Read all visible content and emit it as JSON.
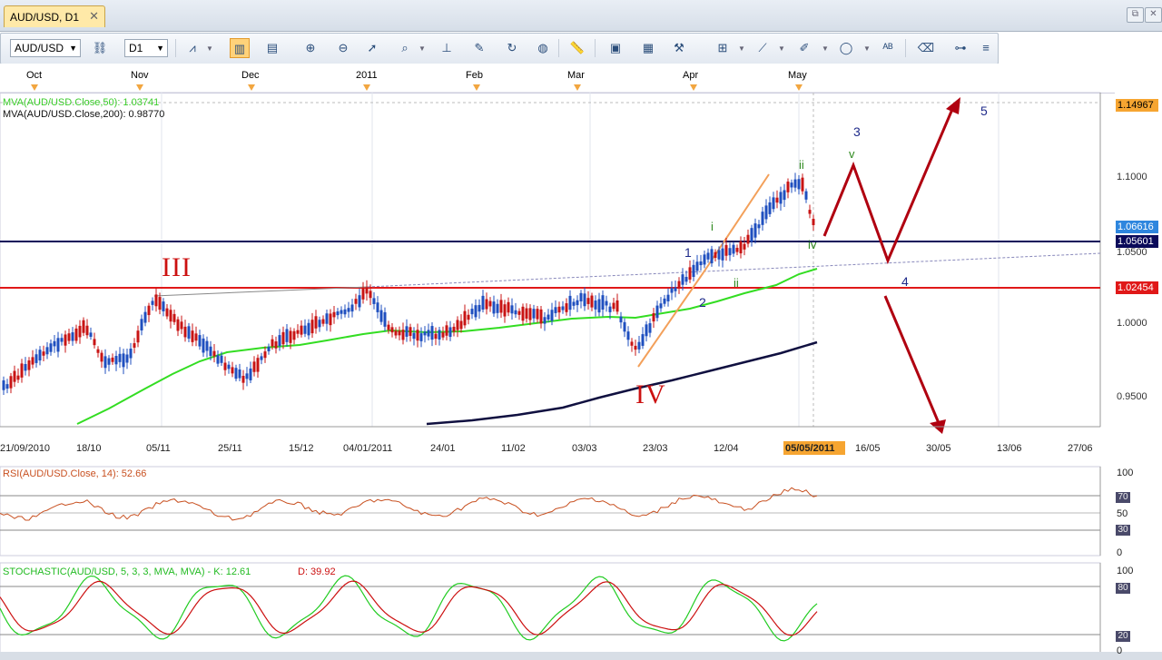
{
  "tab": {
    "title": "AUD/USD, D1",
    "close": "✕"
  },
  "window": {
    "restore_label": "⧉",
    "close_label": "✕"
  },
  "toolbar": {
    "symbol": "AUD/USD",
    "timeframe": "D1",
    "expand": "≡"
  },
  "time_axis": {
    "months": [
      "Oct",
      "Nov",
      "Dec",
      "2011",
      "Feb",
      "Mar",
      "Apr",
      "May"
    ]
  },
  "indicators": {
    "mva50": "MVA(AUD/USD.Close,50): 1.03741",
    "mva200": "MVA(AUD/USD.Close,200): 0.98770",
    "rsi": "RSI(AUD/USD.Close, 14): 52.66",
    "stoch_main": "STOCHASTIC(AUD/USD, 5, 3, 3, MVA, MVA) -  K: 12.61",
    "stoch_d": "D: 39.92"
  },
  "price_labels": {
    "top": "1.14967",
    "ask": "1.06616",
    "level_a": "1.05601",
    "level_b": "1.02454"
  },
  "price_ticks": [
    "1.1000",
    "1.0500",
    "1.0000",
    "0.9500"
  ],
  "date_labels": [
    "21/09/2010",
    "18/10",
    "05/11",
    "25/11",
    "15/12",
    "04/01/2011",
    "24/01",
    "11/02",
    "03/03",
    "23/03",
    "12/04",
    "05/05/2011",
    "16/05",
    "30/05",
    "13/06",
    "27/06"
  ],
  "rsi_scale": [
    "100",
    "70",
    "50",
    "30",
    "0"
  ],
  "stoch_scale": [
    "100",
    "80",
    "20",
    "0"
  ],
  "waves": {
    "w1": "1",
    "w2": "2",
    "w3": "3",
    "w4": "4",
    "w5": "5",
    "III": "III",
    "IV": "IV",
    "i": "i",
    "ii_low": "ii",
    "ii_top": "ii",
    "iv": "iv",
    "v": "v"
  },
  "colors": {
    "bull": "#1f4fbf",
    "bear": "#c81414",
    "mva50": "#33dd22",
    "mva200": "#101040",
    "arrow": "#b00010",
    "orange": "#f3a05a"
  }
}
